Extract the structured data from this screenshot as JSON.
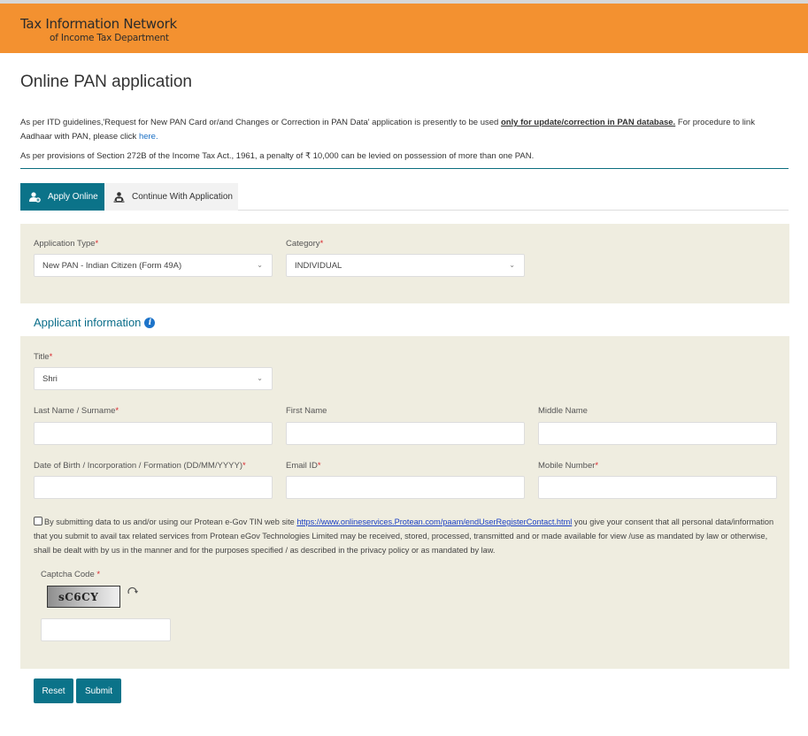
{
  "header": {
    "brand_line1": "Tax Information Network",
    "brand_line2": "of Income Tax Department",
    "brand_color": "#f39130"
  },
  "page": {
    "title": "Online PAN application",
    "notice1_prefix": "As per ITD guidelines,'Request for New PAN Card or/and Changes or Correction in PAN Data' application is presently to be used ",
    "notice1_bold": "only for update/correction in PAN database.",
    "notice1_suffix": " For procedure to link Aadhaar with PAN, please click ",
    "notice1_link": "here.",
    "notice2": "As per provisions of Section 272B of the Income Tax Act., 1961, a penalty of ₹ 10,000 can be levied on possession of more than one PAN."
  },
  "tabs": [
    {
      "label": "Apply Online",
      "icon": "user-plus-icon",
      "active": true
    },
    {
      "label": "Continue With Application",
      "icon": "user-laptop-icon",
      "active": false
    }
  ],
  "application": {
    "type_label": "Application Type",
    "type_value": "New PAN - Indian Citizen (Form 49A)",
    "category_label": "Category",
    "category_value": "INDIVIDUAL"
  },
  "applicant": {
    "section_title": "Applicant information",
    "title_label": "Title",
    "title_value": "Shri",
    "last_name_label": "Last Name / Surname",
    "last_name_value": "",
    "first_name_label": "First Name",
    "first_name_value": "",
    "middle_name_label": "Middle Name",
    "middle_name_value": "",
    "dob_label": "Date of Birth / Incorporation / Formation (DD/MM/YYYY)",
    "dob_value": "",
    "email_label": "Email ID",
    "email_value": "",
    "mobile_label": "Mobile Number",
    "mobile_value": ""
  },
  "consent": {
    "checked": false,
    "text_prefix": "By submitting data to us and/or using our Protean e-Gov TIN web site ",
    "link": "https://www.onlineservices.Protean.com/paam/endUserRegisterContact.html",
    "text_suffix": " you give your consent that all personal data/information that you submit to avail tax related services from Protean eGov Technologies Limited may be received, stored, processed, transmitted and or made available for view /use as mandated by law or otherwise, shall be dealt with by us in the manner and for the purposes specified / as described in the privacy policy or as mandated by law."
  },
  "captcha": {
    "label": "Captcha Code",
    "code": "sC6CY",
    "input_value": ""
  },
  "buttons": {
    "reset": "Reset",
    "submit": "Submit"
  },
  "required_marker": "*"
}
